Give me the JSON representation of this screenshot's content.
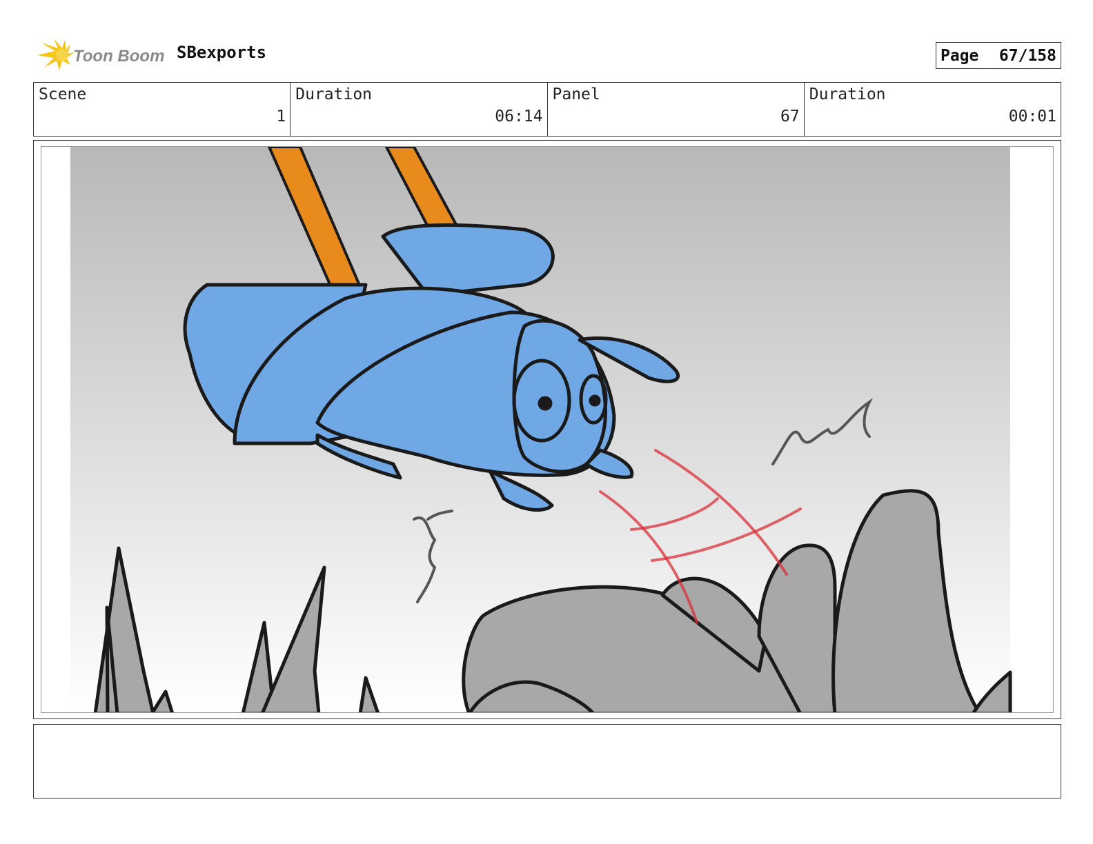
{
  "header": {
    "logo_text": "Toon Boom",
    "project_name": "SBexports",
    "page_label": "Page",
    "page_number": "67/158"
  },
  "info": {
    "scene_label": "Scene",
    "scene_value": "1",
    "scene_duration_label": "Duration",
    "scene_duration_value": "06:14",
    "panel_label": "Panel",
    "panel_value": "67",
    "panel_duration_label": "Duration",
    "panel_duration_value": "00:01"
  },
  "panel": {
    "description": "",
    "colors": {
      "sky_top": "#b8b8b8",
      "sky_bottom": "#ffffff",
      "bee_body": "#6fa8e4",
      "legs": "#e88a1c",
      "rocks": "#a8a8a8",
      "motion_lines": "#d9323a",
      "ink": "#1a1a1a"
    }
  },
  "notes": {
    "text": ""
  }
}
